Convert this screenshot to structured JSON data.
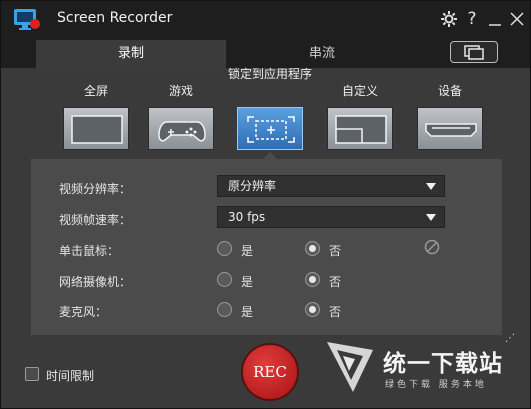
{
  "app": {
    "title": "Screen Recorder",
    "help_label": "?",
    "colors": {
      "accent": "#3a7fcc",
      "rec": "#c81e1e",
      "panel": "#4b4b4b",
      "titlebar": "#1e1e1e"
    }
  },
  "tabs": [
    {
      "label": "录制",
      "active": true
    },
    {
      "label": "串流",
      "active": false
    }
  ],
  "modes": [
    {
      "label": "全屏",
      "icon": "fullscreen-icon",
      "selected": false
    },
    {
      "label": "游戏",
      "icon": "gamepad-icon",
      "selected": false
    },
    {
      "label": "锁定到应用程序",
      "icon": "lock-to-app-icon",
      "selected": true
    },
    {
      "label": "自定义",
      "icon": "custom-region-icon",
      "selected": false
    },
    {
      "label": "设备",
      "icon": "hdmi-device-icon",
      "selected": false
    }
  ],
  "settings": {
    "resolution": {
      "label": "视频分辨率：",
      "value": "原分辨率"
    },
    "framerate": {
      "label": "视频帧速率：",
      "value": "30 fps"
    },
    "mouse_click": {
      "label": "单击鼠标：",
      "yes": "是",
      "no": "否",
      "selected": "no"
    },
    "webcam": {
      "label": "网络摄像机：",
      "yes": "是",
      "no": "否",
      "selected": "no"
    },
    "microphone": {
      "label": "麦克风：",
      "yes": "是",
      "no": "否",
      "selected": "no"
    }
  },
  "bottom": {
    "time_limit_label": "时间限制",
    "time_limit_checked": false,
    "rec_label": "REC",
    "dots": "⋰"
  },
  "watermark": {
    "title": "统一下载站",
    "subtitle": "绿色下载  服务本地"
  }
}
